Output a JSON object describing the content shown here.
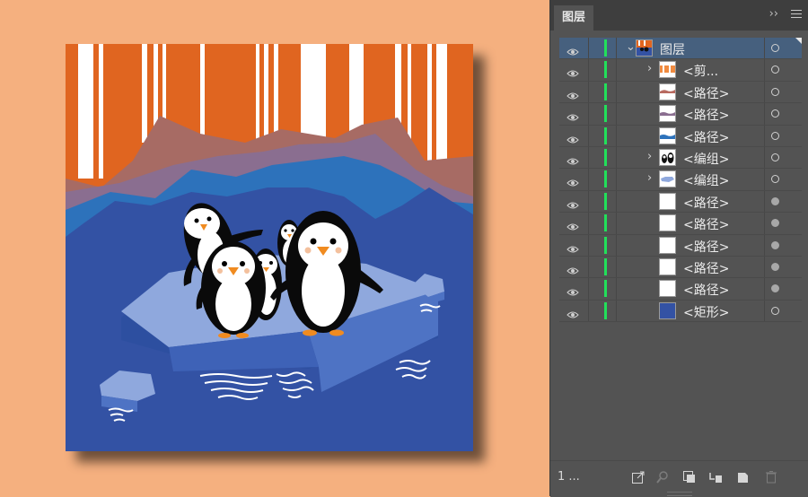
{
  "panel": {
    "tab_label": "图层",
    "collapse_label": "››",
    "layer_count": "1 ..."
  },
  "layers": [
    {
      "label": "图层",
      "chevron": "⌄",
      "target": "empty",
      "thumb": "artwork"
    },
    {
      "label": "<剪...",
      "chevron": "›",
      "target": "empty",
      "thumb": "stripes"
    },
    {
      "label": "<路径>",
      "chevron": "",
      "target": "empty",
      "thumb": "wave-red"
    },
    {
      "label": "<路径>",
      "chevron": "",
      "target": "empty",
      "thumb": "wave-mauve"
    },
    {
      "label": "<路径>",
      "chevron": "",
      "target": "empty",
      "thumb": "wave-blue"
    },
    {
      "label": "<编组>",
      "chevron": "›",
      "target": "empty",
      "thumb": "penguins"
    },
    {
      "label": "<编组>",
      "chevron": "›",
      "target": "empty",
      "thumb": "ice"
    },
    {
      "label": "<路径>",
      "chevron": "",
      "target": "filled",
      "thumb": "blank"
    },
    {
      "label": "<路径>",
      "chevron": "",
      "target": "filled",
      "thumb": "blank"
    },
    {
      "label": "<路径>",
      "chevron": "",
      "target": "filled",
      "thumb": "blank"
    },
    {
      "label": "<路径>",
      "chevron": "",
      "target": "filled",
      "thumb": "blank"
    },
    {
      "label": "<路径>",
      "chevron": "",
      "target": "filled",
      "thumb": "blank"
    },
    {
      "label": "<矩形>",
      "chevron": "",
      "target": "empty",
      "thumb": "rect-blue"
    }
  ],
  "footer_icons": [
    "export-icon",
    "search-icon",
    "clip-mask-icon",
    "new-sublayer-icon",
    "new-layer-icon",
    "trash-icon"
  ],
  "colors": {
    "canvas_bg": "#f5b07f",
    "panel_bg": "#535353",
    "selected_row": "#46607e",
    "layer_color": "#22e05a",
    "art_orange": "#e06520",
    "art_blue": "#3352a4"
  }
}
